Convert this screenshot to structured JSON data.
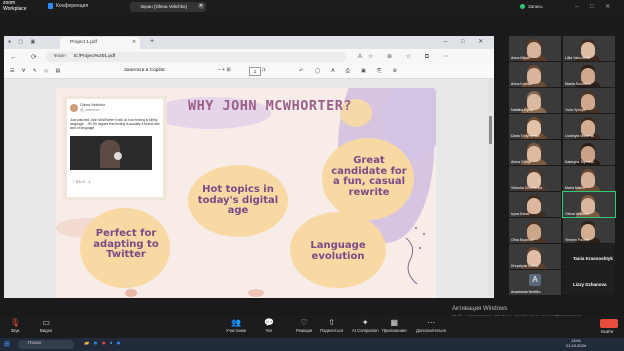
{
  "zoom": {
    "logo_line1": "zoom",
    "logo_line2": "Workplace",
    "meeting_label": "Конференция",
    "share_banner": "Экран (Olena Velichko)",
    "recording_label": "Запись",
    "window_controls": "– □ ✕",
    "accent": "#2d8cff"
  },
  "browser": {
    "tab_icons": "● ▢ ▣",
    "tab_title": "Project 1.pdf",
    "tab_close": "✕",
    "new_tab": "+",
    "window_controls": "– □ ✕",
    "nav_icons": "← ⟳",
    "url_label": "Файл",
    "url_value": "E:/Project%201.pdf",
    "url_icons": "A☆ ⊕ ☆ ⧉ ⋯",
    "pdf_tools_left": "☰ ∀ ✎ ◇ ▤",
    "copilot_label": "Запитати в Copilot",
    "zoom_controls": "–  +  ⊞",
    "page_current": "1",
    "page_of": "/1",
    "pdf_tools_right": "↶ ◯ A ⎙ ▣ ⎘ ⚙"
  },
  "slide": {
    "title": "WHY JOHN MCWHORTER?",
    "cards": [
      "Great candidate for a fun, casual rewrite",
      "Hot topics in today's digital age",
      "Perfect for adapting to Twitter",
      "Language evolution"
    ],
    "tweet": {
      "name": "Olena Velichko",
      "handle": "@_velichkoo",
      "body": "Just watched John McWhorter's talk on how texting is killing language... JK! He argues that texting is actually a brand-new kind of language",
      "footer": "♡ 5   ↻ 2   ◌ 1"
    }
  },
  "participants": [
    {
      "name": "Anna Bilyak",
      "skin": "#d8b39a",
      "hair": "#5a3b28"
    },
    {
      "name": "Liliia Yakovlieva",
      "skin": "#e0bea4",
      "hair": "#3d2a1f"
    },
    {
      "name": "Anna Kushko",
      "skin": "#d7b49a",
      "hair": "#6b4a36"
    },
    {
      "name": "Mariia Sokolova",
      "skin": "#cfa88e",
      "hair": "#2e2018"
    },
    {
      "name": "Nataliia Dynia",
      "skin": "#dbb8a0",
      "hair": "#8a6a4e"
    },
    {
      "name": "Yulia Vynnyk",
      "skin": "#d0a78c",
      "hair": "#4a3326"
    },
    {
      "name": "Daria Trofymenko",
      "skin": "#e3c2aa",
      "hair": "#6c4b33"
    },
    {
      "name": "Liudmyla Motorna",
      "skin": "#d4ae93",
      "hair": "#3a281d"
    },
    {
      "name": "Alena Fedyk",
      "skin": "#ddb99e",
      "hair": "#7a5a40"
    },
    {
      "name": "Kateryna Tsymbal",
      "skin": "#caa184",
      "hair": "#2a1d15"
    },
    {
      "name": "Viktoriia Chernenko",
      "skin": "#e1bfa6",
      "hair": "#553a2a"
    },
    {
      "name": "Maria Mazur",
      "skin": "#d6b097",
      "hair": "#6a4a34"
    },
    {
      "name": "Iryna Kobal",
      "skin": "#dcb79d",
      "hair": "#3f2c20"
    },
    {
      "name": "Olena Velichko",
      "skin": "#d9b59b",
      "hair": "#7b5a3f"
    },
    {
      "name": "Olha Boychuk",
      "skin": "#cda589",
      "hair": "#4b3527"
    },
    {
      "name": "Yevhen Pavliuk",
      "skin": "#d4ad90",
      "hair": "#2d2119"
    },
    {
      "name": "Khrystyna Lesiuk",
      "skin": "#e0bda3",
      "hair": "#5e4230"
    },
    {
      "name": "Tania Krasnoshtyk",
      "black": true
    },
    {
      "name": "Anastasiia Nedilko",
      "avatar": "A"
    },
    {
      "name": "Lizzy Dzhanova",
      "black": true
    }
  ],
  "toolbar": {
    "items": [
      {
        "label": "Звук",
        "icon": "🎙",
        "red": true
      },
      {
        "label": "Видео",
        "icon": "▭"
      },
      {
        "label": "Участники",
        "icon": "👥"
      },
      {
        "label": "Чат",
        "icon": "💬"
      },
      {
        "label": "Реакции",
        "icon": "♡"
      },
      {
        "label": "Поделиться",
        "icon": "⇧"
      },
      {
        "label": "AI Companion",
        "icon": "✦"
      },
      {
        "label": "Приложения",
        "icon": "▦"
      },
      {
        "label": "Дополнительно",
        "icon": "⋯"
      }
    ],
    "leave_label": "Выйти"
  },
  "windows": {
    "activate_title": "Активация Windows",
    "activate_hint": "Чтобы активировать Windows, перейдите в раздел \"Параметры\".",
    "search_placeholder": "Поиск",
    "time": "13:01",
    "date": "21.10.2024"
  }
}
